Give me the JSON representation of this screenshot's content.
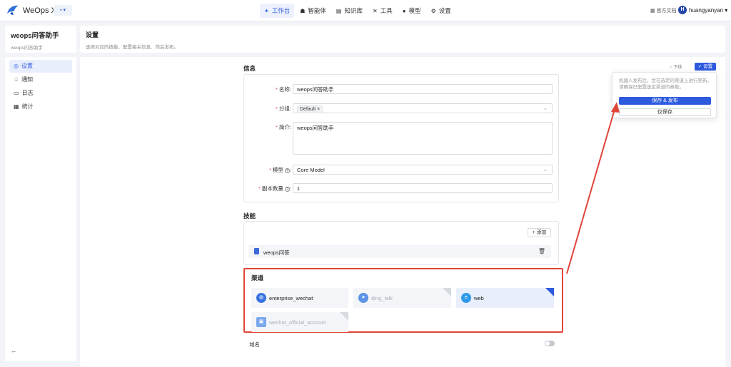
{
  "topbar": {
    "app_name": "WeOps X",
    "app_switch": "▪ ▾",
    "nav": [
      {
        "label": "工作台",
        "icon": "✦",
        "active": true
      },
      {
        "label": "智能体",
        "icon": "☗",
        "active": false
      },
      {
        "label": "知识库",
        "icon": "▤",
        "active": false
      },
      {
        "label": "工具",
        "icon": "✕",
        "active": false
      },
      {
        "label": "模型",
        "icon": "●",
        "active": false
      },
      {
        "label": "设置",
        "icon": "⚙",
        "active": false
      }
    ],
    "doc_link": "官方文档",
    "avatar_letter": "H",
    "username": "huangyanyan"
  },
  "sidebar": {
    "title": "weops问答助手",
    "subtitle": "weops问答助手",
    "items": [
      {
        "label": "设置",
        "icon": "◎",
        "active": true
      },
      {
        "label": "通知",
        "icon": "♤",
        "active": false
      },
      {
        "label": "日志",
        "icon": "▭",
        "active": false
      },
      {
        "label": "统计",
        "icon": "▦",
        "active": false
      }
    ],
    "collapse": "←"
  },
  "content": {
    "title": "设置",
    "subtitle": "选择对应的技能、配置相关信息、然后发布。"
  },
  "actions": {
    "offline": "下线",
    "settings": "设置",
    "settings_icon": "✓"
  },
  "info": {
    "title": "信息",
    "name_label": "名称:",
    "name_value": "weops问答助手",
    "group_label": "分组:",
    "group_tag": "Default",
    "intro_label": "简介:",
    "intro_value": "weops问答助手",
    "model_label": "模型",
    "model_value": "Core Model",
    "replica_label": "副本数量",
    "replica_value": "1"
  },
  "skills": {
    "title": "技能",
    "add_label": "+ 添加",
    "item": "weops问答"
  },
  "channels": {
    "title": "渠道",
    "items": [
      {
        "label": "enterprise_wechat",
        "selected": false,
        "dim": false,
        "color": "#3a73e0"
      },
      {
        "label": "ding_talk",
        "selected": false,
        "dim": true,
        "color": "#5b93e8"
      },
      {
        "label": "web",
        "selected": true,
        "dim": false,
        "color": "#2f9be8"
      },
      {
        "label": "wechat_official_account",
        "selected": false,
        "dim": true,
        "color": "#7aa7ee"
      }
    ]
  },
  "domain": {
    "label": "域名"
  },
  "popover": {
    "message": "机器人发布后，会在选定的渠道上进行更新。请确保已配置选定渠道的参数。",
    "publish": "保存 & 发布",
    "save": "仅保存"
  },
  "colors": {
    "accent": "#2e5bde",
    "highlight": "#e0453a"
  }
}
